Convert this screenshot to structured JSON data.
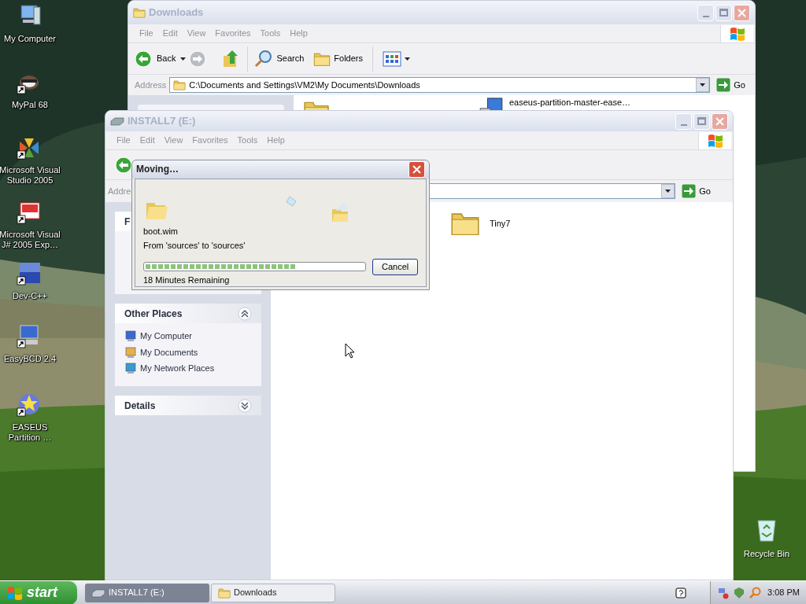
{
  "desktop_icons": [
    {
      "label": "My Computer",
      "shortcut": false
    },
    {
      "label": "MyPal 68",
      "shortcut": true
    },
    {
      "label": "Microsoft Visual Studio 2005",
      "shortcut": true
    },
    {
      "label": "Microsoft Visual J# 2005 Exp…",
      "shortcut": true
    },
    {
      "label": "Dev-C++",
      "shortcut": true
    },
    {
      "label": "EasyBCD 2.4",
      "shortcut": true
    },
    {
      "label": "EASEUS Partition …",
      "shortcut": true
    }
  ],
  "recycle_bin": {
    "label": "Recycle Bin"
  },
  "downloads_window": {
    "title": "Downloads",
    "menu": [
      "File",
      "Edit",
      "View",
      "Favorites",
      "Tools",
      "Help"
    ],
    "toolbar": {
      "back": "Back",
      "search": "Search",
      "folders": "Folders"
    },
    "address": {
      "label": "Address",
      "value": "C:\\Documents and Settings\\VM2\\My Documents\\Downloads",
      "go": "Go"
    },
    "files": [
      {
        "name": "easeus-partition-master-ease…"
      }
    ]
  },
  "install_window": {
    "title": "INSTALL7 (E:)",
    "menu": [
      "File",
      "Edit",
      "View",
      "Favorites",
      "Tools",
      "Help"
    ],
    "address": {
      "label": "Addre",
      "go": "Go"
    },
    "panels": [
      {
        "title": "F"
      },
      {
        "title": "Other Places",
        "expanded": true,
        "items": [
          "My Computer",
          "My Documents",
          "My Network Places"
        ]
      },
      {
        "title": "Details",
        "expanded": false
      }
    ],
    "files": [
      {
        "name": "Tiny7"
      }
    ]
  },
  "dialog": {
    "title": "Moving…",
    "file": "boot.wim",
    "detail": "From 'sources' to 'sources'",
    "level": 0.69,
    "remaining": "18 Minutes Remaining",
    "cancel": "Cancel"
  },
  "taskbar": {
    "start": "start",
    "tasks": [
      {
        "label": "INSTALL7 (E:)",
        "selected": true
      },
      {
        "label": "Downloads",
        "selected": false
      }
    ],
    "clock": "3:08 PM"
  }
}
